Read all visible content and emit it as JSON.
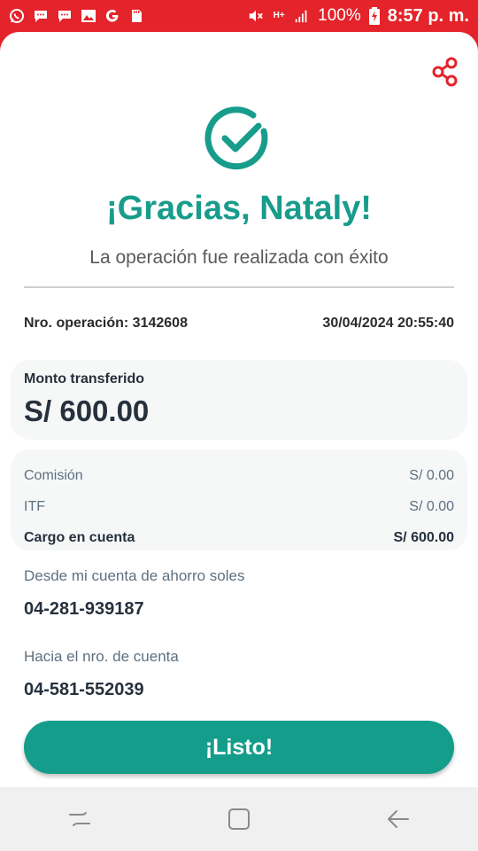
{
  "status_bar": {
    "battery": "100%",
    "time": "8:57 p. m.",
    "network": "H+",
    "icons_left": [
      "whatsapp-icon",
      "message-icon",
      "message-icon",
      "gallery-icon",
      "google-icon",
      "sd-card-icon"
    ],
    "icons_right": [
      "mute-icon",
      "network-icon",
      "signal-icon",
      "battery-icon"
    ]
  },
  "colors": {
    "status_bar": "#e4232a",
    "accent": "#189c8c",
    "button": "#159d8c",
    "share": "#e4232a"
  },
  "receipt": {
    "title": "¡Gracias, Nataly!",
    "subtitle": "La operación fue realizada con éxito",
    "operation_number": "Nro. operación: 3142608",
    "datetime": "30/04/2024 20:55:40",
    "amount_label": "Monto transferido",
    "amount_value": "S/ 600.00",
    "fees": [
      {
        "label": "Comisión",
        "value": "S/ 0.00"
      },
      {
        "label": "ITF",
        "value": "S/ 0.00"
      },
      {
        "label": "Cargo en cuenta",
        "value": "S/ 600.00"
      }
    ],
    "from_label": "Desde mi cuenta de ahorro soles",
    "from_account": "04-281-939187",
    "to_label": "Hacia el nro. de cuenta",
    "to_account": "04-581-552039",
    "done_button": "¡Listo!"
  },
  "nav_bar": {
    "buttons": [
      "recents-icon",
      "home-icon",
      "back-icon"
    ]
  }
}
